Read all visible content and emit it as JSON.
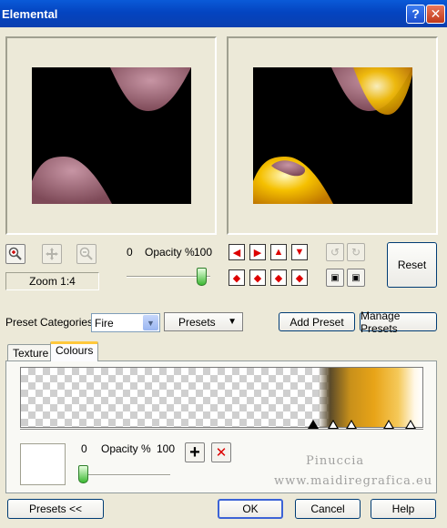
{
  "window": {
    "title": "Elemental",
    "help_glyph": "?",
    "close_glyph": "✕"
  },
  "zoom": {
    "label": "Zoom 1:4"
  },
  "opacity_top": {
    "min": "0",
    "label": "Opacity %",
    "max": "100",
    "value_percent": 100
  },
  "reset_label": "Reset",
  "preset_categories": {
    "label": "Preset Categories:",
    "value": "Fire",
    "presets_label": "Presets"
  },
  "add_preset_label": "Add Preset",
  "manage_presets_label": "Manage Presets",
  "tabs": [
    {
      "label": "Texture"
    },
    {
      "label": "Colours"
    }
  ],
  "opacity_bottom": {
    "min": "0",
    "label": "Opacity %",
    "max": "100",
    "value_percent": 0
  },
  "plus_glyph": "+",
  "delete_glyph": "✕",
  "watermark": {
    "line1": "Pinuccia",
    "line2": "www.maidiregrafica.eu"
  },
  "footer": {
    "presets_toggle": "Presets  <<",
    "ok": "OK",
    "cancel": "Cancel",
    "help": "Help"
  },
  "colors": {
    "titlebar": "#0444c0",
    "gradient_orange": "#e8a418",
    "gradient_dark": "#5a4a2a"
  }
}
